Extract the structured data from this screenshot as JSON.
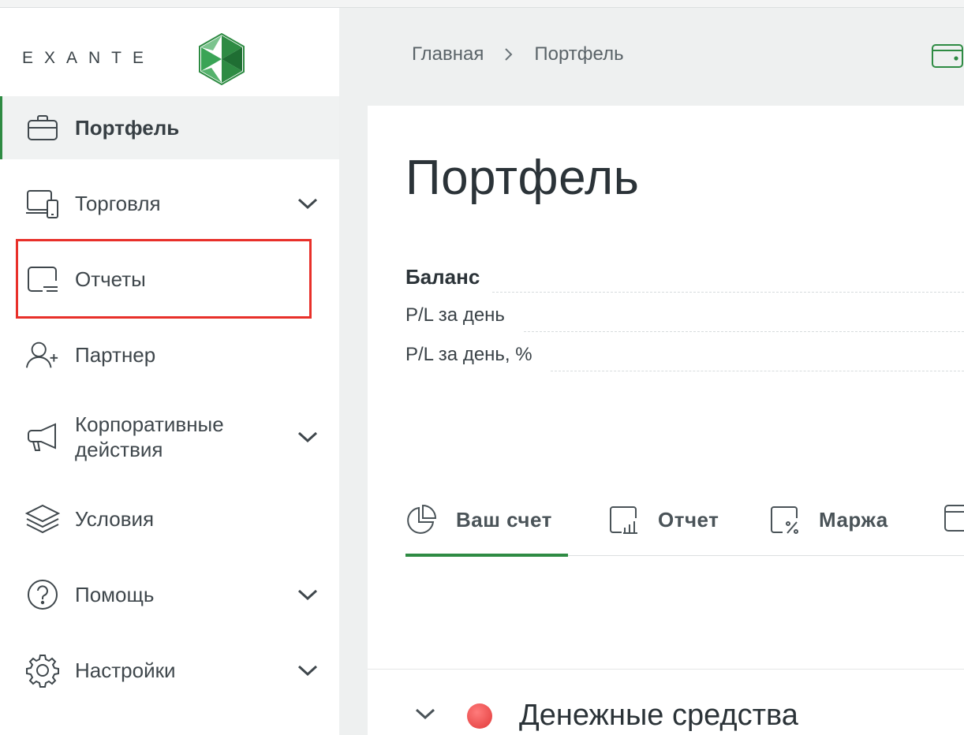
{
  "brand": {
    "name": "EXANTE",
    "accent": "#2e8b43",
    "highlight_color": "#e8302a"
  },
  "sidebar": {
    "items": [
      {
        "label": "Портфель",
        "icon": "briefcase-icon",
        "active": true,
        "expandable": false
      },
      {
        "label": "Торговля",
        "icon": "devices-icon",
        "active": false,
        "expandable": true
      },
      {
        "label": "Отчеты",
        "icon": "report-icon",
        "active": false,
        "expandable": false
      },
      {
        "label": "Партнер",
        "icon": "user-plus-icon",
        "active": false,
        "expandable": false
      },
      {
        "label_line1": "Корпоративные",
        "label_line2": "действия",
        "icon": "megaphone-icon",
        "active": false,
        "expandable": true
      },
      {
        "label": "Условия",
        "icon": "layers-icon",
        "active": false,
        "expandable": false
      },
      {
        "label": "Помощь",
        "icon": "help-icon",
        "active": false,
        "expandable": true
      },
      {
        "label": "Настройки",
        "icon": "gear-icon",
        "active": false,
        "expandable": true
      }
    ]
  },
  "breadcrumb": {
    "home": "Главная",
    "current": "Портфель"
  },
  "main": {
    "title": "Портфель",
    "summary": {
      "balance_label": "Баланс",
      "pl_day_label": "P/L за день",
      "pl_day_pct_label": "P/L за день, %"
    },
    "tabs": [
      {
        "label": "Ваш счет",
        "icon": "pie-chart-icon",
        "active": true
      },
      {
        "label": "Отчет",
        "icon": "bar-report-icon",
        "active": false
      },
      {
        "label": "Маржа",
        "icon": "percent-icon",
        "active": false
      }
    ],
    "section": {
      "label": "Денежные средства",
      "status_color": "#e13a3a"
    }
  }
}
